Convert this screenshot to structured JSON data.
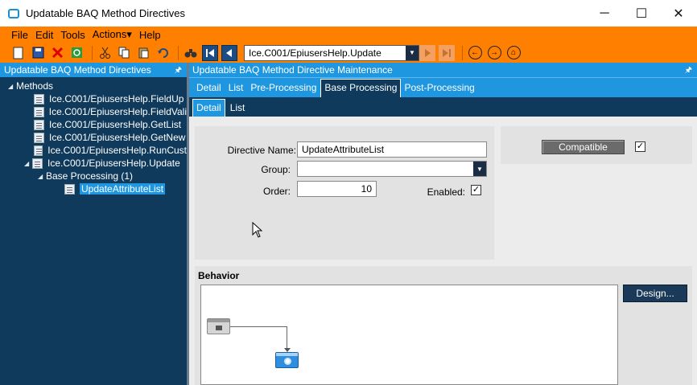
{
  "window": {
    "title": "Updatable BAQ Method Directives",
    "minimize": "─",
    "maximize": "☐",
    "close": "✕"
  },
  "menu": [
    "File",
    "Edit",
    "Tools",
    "Actions▾",
    "Help"
  ],
  "toolbar": {
    "search_value": "Ice.C001/EpiusersHelp.Update"
  },
  "left_panel": {
    "title": "Updatable BAQ Method Directives",
    "pin": "🖈",
    "root": "Methods",
    "methods": [
      "Ice.C001/EpiusersHelp.FieldUp",
      "Ice.C001/EpiusersHelp.FieldVali",
      "Ice.C001/EpiusersHelp.GetList",
      "Ice.C001/EpiusersHelp.GetNew",
      "Ice.C001/EpiusersHelp.RunCust",
      "Ice.C001/EpiusersHelp.Update"
    ],
    "group": "Base Processing (1)",
    "directive": "UpdateAttributeList"
  },
  "right_panel": {
    "title": "Updatable BAQ Method Directive Maintenance",
    "pin": "🖈",
    "tabs": [
      "Detail",
      "List",
      "Pre-Processing",
      "Base Processing",
      "Post-Processing"
    ],
    "subtabs": [
      "Detail",
      "List"
    ]
  },
  "form": {
    "directive_name_label": "Directive Name:",
    "directive_name_value": "UpdateAttributeList",
    "group_label": "Group:",
    "group_value": "",
    "order_label": "Order:",
    "order_value": "10",
    "enabled_label": "Enabled:",
    "enabled": true,
    "compatible_label": "Compatible",
    "compatible": true
  },
  "behavior": {
    "title": "Behavior",
    "design_label": "Design..."
  },
  "colors": {
    "accent_orange": "#ff7f00",
    "header_blue": "#1f97e0",
    "panel_navy": "#0f3a5c"
  }
}
